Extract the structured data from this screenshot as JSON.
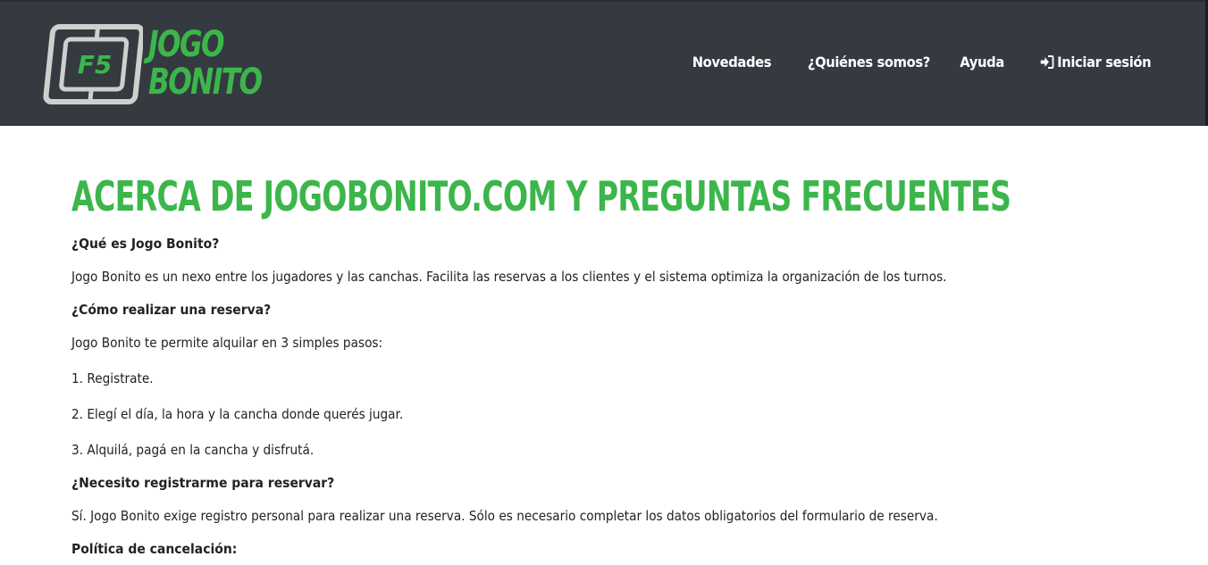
{
  "brand": {
    "logo_badge": "F5",
    "name_line1": "JOGO",
    "name_line2": "BONITO",
    "color_green": "#3cb64b",
    "color_header": "#343a40"
  },
  "nav": {
    "items": [
      {
        "label": "Novedades"
      },
      {
        "label": "¿Quiénes somos?"
      },
      {
        "label": "Ayuda"
      },
      {
        "label": "Iniciar sesión",
        "icon": "sign-in-icon"
      }
    ]
  },
  "page": {
    "title": "ACERCA DE JOGOBONITO.COM Y PREGUNTAS FRECUENTES",
    "faq": [
      {
        "type": "q",
        "text": "¿Qué es Jogo Bonito?"
      },
      {
        "type": "p",
        "text": "Jogo Bonito es un nexo entre los jugadores y las canchas. Facilita las reservas a los clientes y el sistema optimiza la organización de los turnos."
      },
      {
        "type": "q",
        "text": "¿Cómo realizar una reserva?"
      },
      {
        "type": "p",
        "text": "Jogo Bonito te permite alquilar en 3 simples pasos:"
      },
      {
        "type": "p",
        "text": "1. Registrate."
      },
      {
        "type": "p",
        "text": "2. Elegí el día, la hora y la cancha donde querés jugar."
      },
      {
        "type": "p",
        "text": "3. Alquilá, pagá en la cancha y disfrutá."
      },
      {
        "type": "q",
        "text": "¿Necesito registrarme para reservar?"
      },
      {
        "type": "p",
        "text": "Sí. Jogo Bonito exige registro personal para realizar una reserva. Sólo es necesario completar los datos obligatorios del formulario de reserva."
      },
      {
        "type": "q",
        "text": "Política de cancelación:"
      }
    ]
  }
}
